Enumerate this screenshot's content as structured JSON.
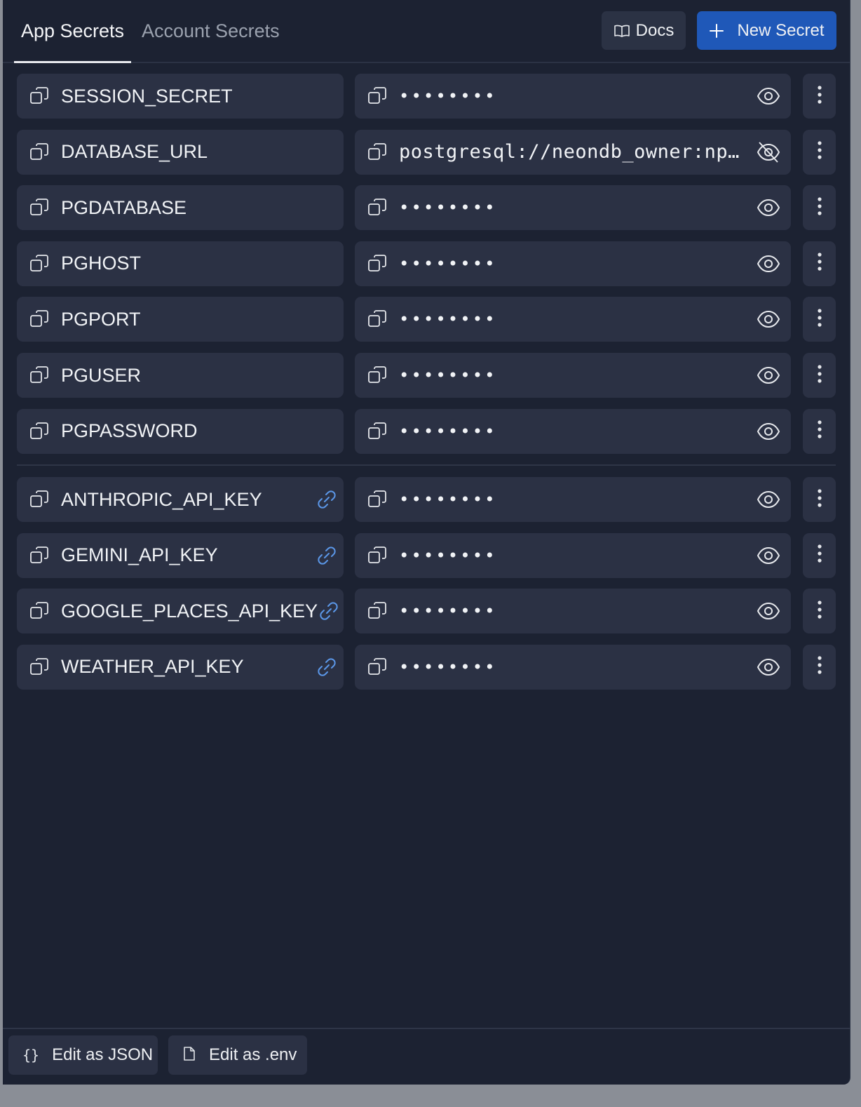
{
  "tabs": {
    "app": "App Secrets",
    "account": "Account Secrets"
  },
  "header": {
    "docs_label": "Docs",
    "new_secret_label": "New Secret"
  },
  "colors": {
    "background": "#1c2232",
    "cell": "#2b3144",
    "primary_button": "#1f58b8",
    "link_icon": "#5b97e8"
  },
  "app_secrets": [
    {
      "key": "SESSION_SECRET",
      "value": "••••••••",
      "masked": true,
      "linked": false
    },
    {
      "key": "DATABASE_URL",
      "value": "postgresql://neondb_owner:np…",
      "masked": false,
      "linked": false
    },
    {
      "key": "PGDATABASE",
      "value": "••••••••",
      "masked": true,
      "linked": false
    },
    {
      "key": "PGHOST",
      "value": "••••••••",
      "masked": true,
      "linked": false
    },
    {
      "key": "PGPORT",
      "value": "••••••••",
      "masked": true,
      "linked": false
    },
    {
      "key": "PGUSER",
      "value": "••••••••",
      "masked": true,
      "linked": false
    },
    {
      "key": "PGPASSWORD",
      "value": "••••••••",
      "masked": true,
      "linked": false
    }
  ],
  "linked_secrets": [
    {
      "key": "ANTHROPIC_API_KEY",
      "value": "••••••••",
      "masked": true,
      "linked": true
    },
    {
      "key": "GEMINI_API_KEY",
      "value": "••••••••",
      "masked": true,
      "linked": true
    },
    {
      "key": "GOOGLE_PLACES_API_KEY",
      "value": "••••••••",
      "masked": true,
      "linked": true
    },
    {
      "key": "WEATHER_API_KEY",
      "value": "••••••••",
      "masked": true,
      "linked": true
    }
  ],
  "footer": {
    "edit_json_icon": "{}",
    "edit_json_label": "Edit as JSON",
    "edit_env_label": "Edit as .env"
  }
}
